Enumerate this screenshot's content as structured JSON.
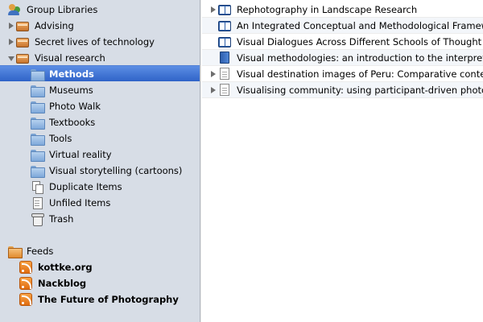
{
  "sidebar": {
    "header": {
      "label": "Group Libraries",
      "icon": "group-libraries-icon"
    },
    "libraries": [
      {
        "label": "Advising",
        "state": "collapsed",
        "icon": "library-icon"
      },
      {
        "label": "Secret lives of technology",
        "state": "collapsed",
        "icon": "library-icon"
      },
      {
        "label": "Visual research",
        "state": "expanded",
        "icon": "library-icon"
      }
    ],
    "collections": [
      {
        "label": "Methods",
        "icon": "folder-icon",
        "selected": true
      },
      {
        "label": "Museums",
        "icon": "folder-icon"
      },
      {
        "label": "Photo Walk",
        "icon": "folder-icon"
      },
      {
        "label": "Textbooks",
        "icon": "folder-icon"
      },
      {
        "label": "Tools",
        "icon": "folder-icon"
      },
      {
        "label": "Virtual reality",
        "icon": "folder-icon"
      },
      {
        "label": "Visual storytelling (cartoons)",
        "icon": "folder-icon"
      },
      {
        "label": "Duplicate Items",
        "icon": "duplicate-items-icon"
      },
      {
        "label": "Unfiled Items",
        "icon": "unfiled-items-icon"
      },
      {
        "label": "Trash",
        "icon": "trash-icon"
      }
    ],
    "feeds": {
      "label": "Feeds",
      "icon": "feeds-icon",
      "items": [
        {
          "label": "kottke.org",
          "icon": "rss-icon"
        },
        {
          "label": "Nackblog",
          "icon": "rss-icon"
        },
        {
          "label": "The Future of Photography",
          "icon": "rss-icon"
        }
      ]
    }
  },
  "items": [
    {
      "title": "Rephotography in Landscape Research",
      "icon": "book-icon",
      "expandable": true
    },
    {
      "title": "An Integrated Conceptual and Methodological Framework",
      "icon": "book-icon",
      "expandable": false
    },
    {
      "title": "Visual Dialogues Across Different Schools of Thought",
      "icon": "book-icon",
      "expandable": false
    },
    {
      "title": "Visual methodologies: an introduction to the interpretation",
      "icon": "book-cover-icon",
      "expandable": false
    },
    {
      "title": "Visual destination images of Peru: Comparative content a",
      "icon": "document-icon",
      "expandable": true
    },
    {
      "title": "Visualising community: using participant-driven photo-e",
      "icon": "document-icon",
      "expandable": true
    }
  ],
  "colors": {
    "sidebar_bg": "#d7dde6",
    "selection": "#3a6fd1"
  }
}
